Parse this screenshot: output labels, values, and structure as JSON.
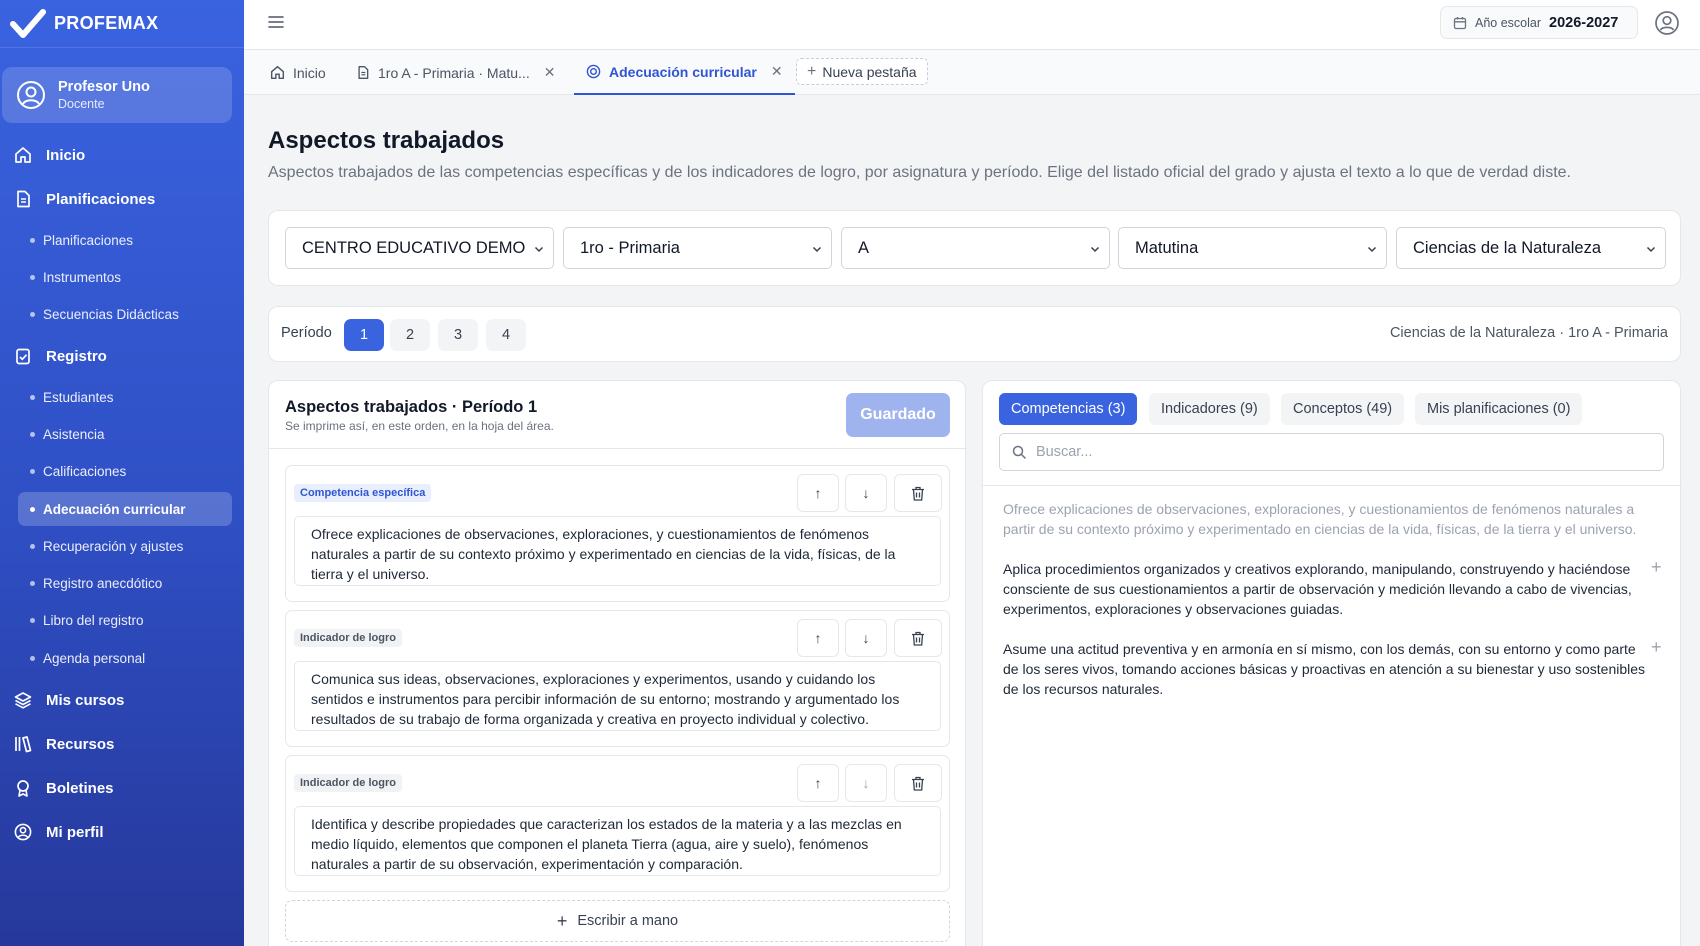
{
  "brand": {
    "name": "PROFEMAX"
  },
  "user": {
    "name": "Profesor Uno",
    "role": "Docente"
  },
  "sidebar": {
    "inicio": "Inicio",
    "planificaciones": "Planificaciones",
    "planificaciones_sub": [
      "Planificaciones",
      "Instrumentos",
      "Secuencias Didácticas"
    ],
    "registro": "Registro",
    "registro_sub": [
      "Estudiantes",
      "Asistencia",
      "Calificaciones",
      "Adecuación curricular",
      "Recuperación y ajustes",
      "Registro anecdótico",
      "Libro del registro",
      "Agenda personal"
    ],
    "mis_cursos": "Mis cursos",
    "recursos": "Recursos",
    "boletines": "Boletines",
    "mi_perfil": "Mi perfil"
  },
  "topbar": {
    "year_label": "Año escolar",
    "year_value": "2026-2027"
  },
  "tabs": [
    {
      "label": "Inicio"
    },
    {
      "label": "1ro A - Primaria · Matu..."
    },
    {
      "label": "Adecuación curricular"
    }
  ],
  "new_tab": "Nueva pestaña",
  "page": {
    "title": "Aspectos trabajados",
    "subtitle": "Aspectos trabajados de las competencias específicas y de los indicadores de logro, por asignatura y período. Elige del listado oficial del grado y ajusta el texto a lo que de verdad diste."
  },
  "filters": {
    "centro": "CENTRO EDUCATIVO DEMO",
    "grado": "1ro - Primaria",
    "seccion": "A",
    "tanda": "Matutina",
    "asignatura": "Ciencias de la Naturaleza"
  },
  "periodo": {
    "label": "Período",
    "options": [
      "1",
      "2",
      "3",
      "4"
    ],
    "selected": "1",
    "context": "Ciencias de la Naturaleza · 1ro A - Primaria"
  },
  "left_panel": {
    "title": "Aspectos trabajados · Período 1",
    "subtitle": "Se imprime así, en este orden, en la hoja del área.",
    "saved_label": "Guardado",
    "items": [
      {
        "type": "Competencia específica",
        "text": "Ofrece explicaciones de observaciones, exploraciones, y cuestionamientos de fenómenos naturales a partir de su contexto próximo y experimentado en ciencias de la vida, físicas, de la tierra y el universo."
      },
      {
        "type": "Indicador de logro",
        "text": "Comunica sus ideas, observaciones, exploraciones y experimentos, usando y cuidando los sentidos e instrumentos para percibir información de su entorno; mostrando y argumentado los resultados de su trabajo de forma organizada y creativa en proyecto individual y colectivo."
      },
      {
        "type": "Indicador de logro",
        "text": "Identifica y describe propiedades que caracterizan los estados de la materia y a las mezclas en medio líquido, elementos que componen el planeta Tierra (agua, aire y suelo), fenómenos naturales a partir de su observación, experimentación y comparación."
      }
    ],
    "write_label": "Escribir a mano"
  },
  "right_panel": {
    "tabs": [
      "Competencias (3)",
      "Indicadores (9)",
      "Conceptos (49)",
      "Mis planificaciones (0)"
    ],
    "search_placeholder": "Buscar...",
    "suggestions": [
      "Ofrece explicaciones de observaciones, exploraciones, y cuestionamientos de fenómenos naturales a partir de su contexto próximo y experimentado en ciencias de la vida, físicas, de la tierra y el universo.",
      "Aplica procedimientos organizados y creativos explorando, manipulando, construyendo y haciéndose consciente de sus cuestionamientos a partir de observación y medición llevando a cabo de vivencias, experimentos, exploraciones y observaciones guiadas.",
      "Asume una actitud preventiva y en armonía en sí mismo, con los demás, con su entorno y como parte de los seres vivos, tomando acciones básicas y proactivas en atención a su bienestar y uso sostenibles de los recursos naturales."
    ]
  },
  "colors": {
    "accent": "#3a63e0",
    "sidebar_dark": "#26389a",
    "saved": "#9fb4ee"
  }
}
